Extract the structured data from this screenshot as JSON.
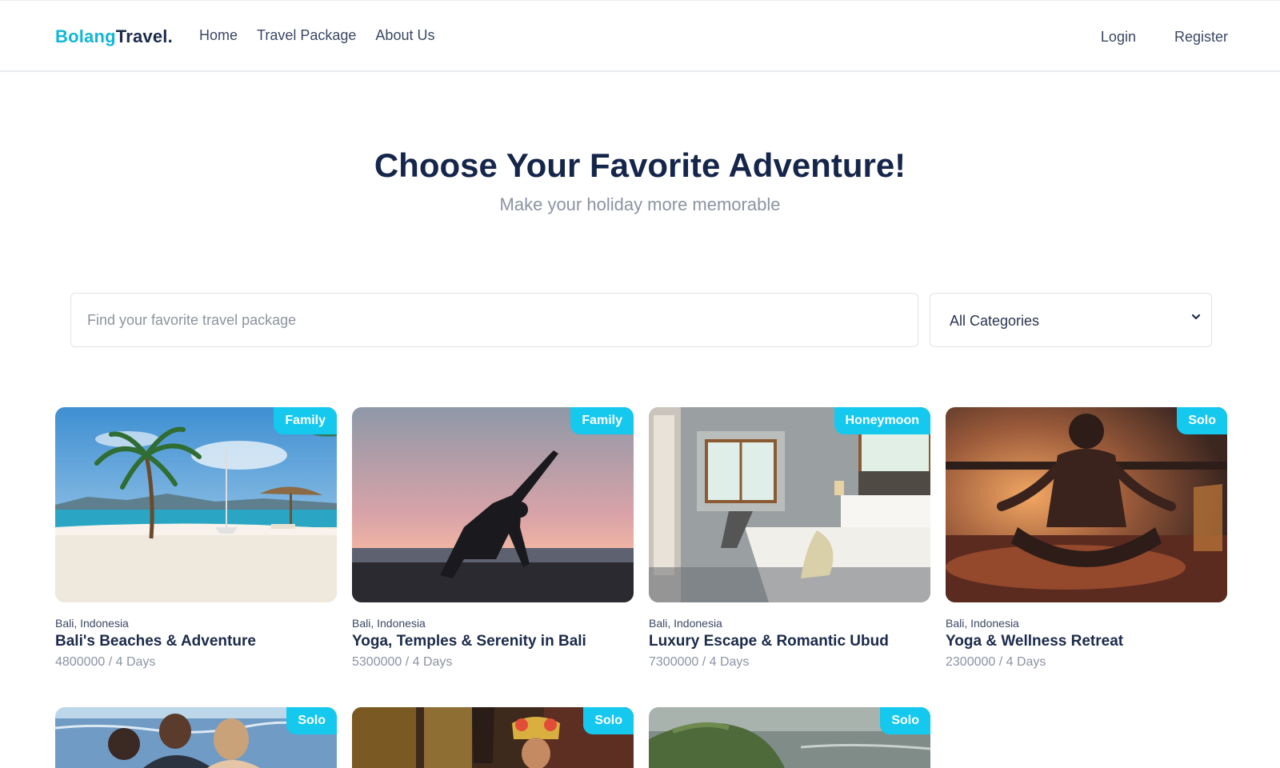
{
  "nav": {
    "brand_part1": "Bolang",
    "brand_part2": "Travel.",
    "links": [
      "Home",
      "Travel Package",
      "About Us"
    ],
    "login": "Login",
    "register": "Register"
  },
  "hero": {
    "title": "Choose Your Favorite Adventure!",
    "subtitle": "Make your holiday more memorable"
  },
  "search": {
    "placeholder": "Find your favorite travel package",
    "category_selected": "All Categories"
  },
  "packages": [
    {
      "category": "Family",
      "location": "Bali, Indonesia",
      "name": "Bali's Beaches & Adventure",
      "price_duration": "4800000 / 4 Days",
      "image": "beach-photo"
    },
    {
      "category": "Family",
      "location": "Bali, Indonesia",
      "name": "Yoga, Temples & Serenity in Bali",
      "price_duration": "5300000 / 4 Days",
      "image": "yoga-sunset-photo"
    },
    {
      "category": "Honeymoon",
      "location": "Bali, Indonesia",
      "name": "Luxury Escape & Romantic Ubud",
      "price_duration": "7300000 / 4 Days",
      "image": "bedroom-photo"
    },
    {
      "category": "Solo",
      "location": "Bali, Indonesia",
      "name": "Yoga & Wellness Retreat",
      "price_duration": "2300000 / 4 Days",
      "image": "meditation-photo"
    },
    {
      "category": "Solo",
      "image": "family-sea-photo"
    },
    {
      "category": "Solo",
      "image": "balinese-dancer-photo"
    },
    {
      "category": "Solo",
      "image": "cliff-sea-photo"
    }
  ],
  "colors": {
    "accent": "#14c8ee",
    "brand_blue": "#12b6d6",
    "heading": "#15264a",
    "muted": "#8c93a2"
  }
}
